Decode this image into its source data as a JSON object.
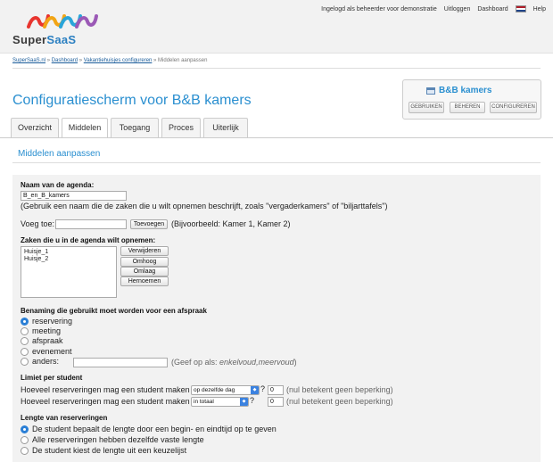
{
  "brand": {
    "name_part1": "Super",
    "name_part2": "SaaS"
  },
  "topnav": {
    "logged_in": "Ingelogd als beheerder voor demonstratie",
    "logout": "Uitloggen",
    "dashboard": "Dashboard",
    "help": "Help"
  },
  "breadcrumb": {
    "home": "SuperSaaS.nl",
    "dashboard": "Dashboard",
    "config": "Vakantiehuisjes configureren",
    "current": "» Middelen aanpassen",
    "sep": "»"
  },
  "page_title": "Configuratiescherm voor B&B kamers",
  "agenda": {
    "name": "B&B kamers",
    "buttons": [
      "GEBRUIKEN",
      "BEHEREN",
      "CONFIGUREREN"
    ]
  },
  "tabs": [
    "Overzicht",
    "Middelen",
    "Toegang",
    "Proces",
    "Uiterlijk"
  ],
  "section_title": "Middelen aanpassen",
  "form": {
    "agenda_name_label": "Naam van de agenda:",
    "agenda_name_value": "B_en_B_kamers",
    "agenda_name_hint": "(Gebruik een naam die de zaken die u wilt opnemen beschrijft, zoals \"vergaderkamers\" of \"biljarttafels\")",
    "add_label": "Voeg toe:",
    "add_value": "",
    "add_button": "Toevoegen",
    "add_example": "(Bijvoorbeeld: Kamer 1, Kamer 2)",
    "items_label": "Zaken die u in de agenda wilt opnemen:",
    "items": [
      "Huisje_1",
      "Huisje_2"
    ],
    "item_buttons": [
      "Verwijderen",
      "Omhoog",
      "Omlaag",
      "Hernoemen"
    ],
    "naming_label": "Benaming die gebruikt moet worden voor een afspraak",
    "naming_options": [
      "reservering",
      "meeting",
      "afspraak",
      "evenement",
      "anders:"
    ],
    "naming_selected": 0,
    "naming_other_value": "",
    "naming_other_hint_prefix": "(Geef op als: ",
    "naming_other_hint_italic": "enkelvoud,meervoud",
    "naming_other_hint_suffix": ")",
    "limit_label": "Limiet per student",
    "limit_rows": [
      {
        "label": "Hoeveel reserveringen mag een student maken",
        "select": "op dezelfde dag",
        "q": "?",
        "value": "0",
        "hint": "(nul betekent geen beperking)"
      },
      {
        "label": "Hoeveel reserveringen mag een student maken",
        "select": "in totaal",
        "q": "?",
        "value": "0",
        "hint": "(nul betekent geen beperking)"
      }
    ],
    "length_label": "Lengte van reserveringen",
    "length_options": [
      "De student bepaalt de lengte door een begin- en eindtijd op te geven",
      "Alle reserveringen hebben dezelfde vaste lengte",
      "De student kiest de lengte uit een keuzelijst"
    ],
    "length_selected": 0
  },
  "colors": {
    "accent": "#2a8fd0",
    "radio_on": "#2a7fd6",
    "panel_bg": "#f2f2f2"
  },
  "icons": {
    "logo": "supersaas-logo-icon",
    "flag": "netherlands-flag-icon",
    "calendar": "calendar-icon",
    "select_arrow": "chevron-updown-icon"
  }
}
